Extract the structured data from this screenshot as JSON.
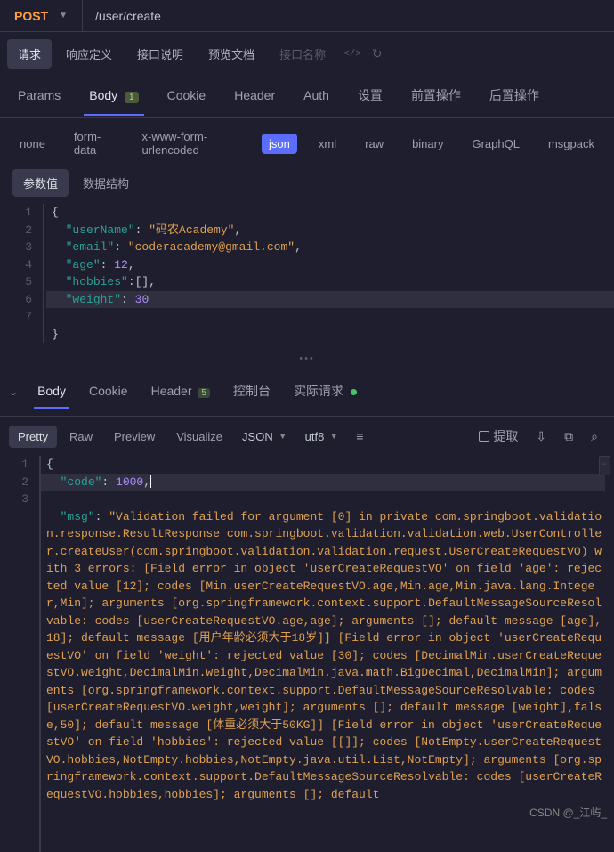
{
  "topbar": {
    "method": "POST",
    "url": "/user/create"
  },
  "requestTabs": {
    "items": [
      "请求",
      "响应定义",
      "接口说明",
      "预览文档"
    ],
    "active": 0,
    "placeholder": "接口名称"
  },
  "mainTabs": {
    "items": [
      "Params",
      "Body",
      "Cookie",
      "Header",
      "Auth",
      "设置",
      "前置操作",
      "后置操作"
    ],
    "active": 1,
    "bodyBadge": "1"
  },
  "bodyTypes": {
    "items": [
      "none",
      "form-data",
      "x-www-form-urlencoded",
      "json",
      "xml",
      "raw",
      "binary",
      "GraphQL",
      "msgpack"
    ],
    "active": 3
  },
  "subTabs": {
    "items": [
      "参数值",
      "数据结构"
    ],
    "active": 0
  },
  "requestBody": {
    "lines": [
      "1",
      "2",
      "3",
      "4",
      "5",
      "6",
      "7"
    ],
    "json": {
      "userName": "码农Academy",
      "email": "coderacademy@gmail.com",
      "age": 12,
      "hobbies": [],
      "weight": 30
    }
  },
  "responseTabs": {
    "items": [
      "Body",
      "Cookie",
      "Header",
      "控制台",
      "实际请求"
    ],
    "active": 0,
    "headerBadge": "5"
  },
  "viewbar": {
    "items": [
      "Pretty",
      "Raw",
      "Preview",
      "Visualize"
    ],
    "active": 0,
    "format": "JSON",
    "encoding": "utf8",
    "extract": "提取"
  },
  "responseBody": {
    "gutterLines": [
      "1",
      "2",
      "3"
    ],
    "code": 1000,
    "msg": "Validation failed for argument [0] in private com.springboot.validation.response.ResultResponse<java.lang.Void> com.springboot.validation.validation.web.UserController.createUser(com.springboot.validation.validation.request.UserCreateRequestVO) with 3 errors: [Field error in object 'userCreateRequestVO' on field 'age': rejected value [12]; codes [Min.userCreateRequestVO.age,Min.age,Min.java.lang.Integer,Min]; arguments [org.springframework.context.support.DefaultMessageSourceResolvable: codes [userCreateRequestVO.age,age]; arguments []; default message [age],18]; default message [用户年龄必须大于18岁]] [Field error in object 'userCreateRequestVO' on field 'weight': rejected value [30]; codes [DecimalMin.userCreateRequestVO.weight,DecimalMin.weight,DecimalMin.java.math.BigDecimal,DecimalMin]; arguments [org.springframework.context.support.DefaultMessageSourceResolvable: codes [userCreateRequestVO.weight,weight]; arguments []; default message [weight],false,50]; default message [体重必须大于50KG]] [Field error in object 'userCreateRequestVO' on field 'hobbies': rejected value [[]]; codes [NotEmpty.userCreateRequestVO.hobbies,NotEmpty.hobbies,NotEmpty.java.util.List,NotEmpty]; arguments [org.springframework.context.support.DefaultMessageSourceResolvable: codes [userCreateRequestVO.hobbies,hobbies]; arguments []; default"
  },
  "watermark": "CSDN @_江屿_"
}
